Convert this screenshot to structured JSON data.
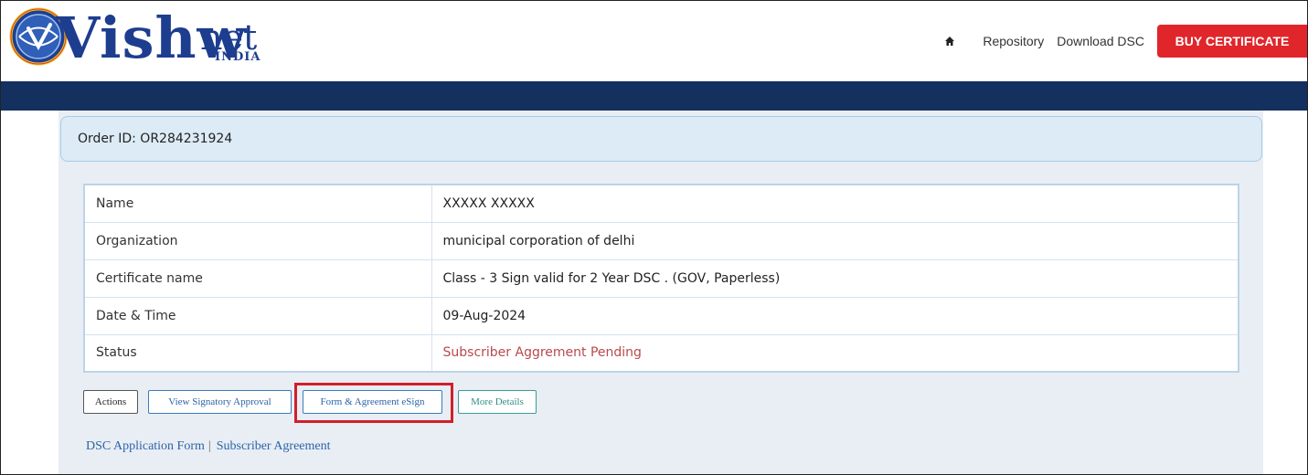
{
  "header": {
    "logo_main": "Vishw",
    "logo_net": "net",
    "logo_india": "INDIA",
    "nav": {
      "home_icon": "home-icon",
      "repository": "Repository",
      "download_dsc": "Download DSC",
      "buy_certificate": "BUY CERTIFICATE"
    }
  },
  "order": {
    "label": "Order ID: OR284231924"
  },
  "details": [
    {
      "label": "Name",
      "value": "XXXXX XXXXX"
    },
    {
      "label": "Organization",
      "value": "municipal corporation of delhi"
    },
    {
      "label": "Certificate name",
      "value": "Class - 3 Sign valid for 2 Year DSC . (GOV, Paperless)"
    },
    {
      "label": "Date & Time",
      "value": "09-Aug-2024"
    },
    {
      "label": "Status",
      "value": "Subscriber Aggrement Pending"
    }
  ],
  "actions": {
    "actions": "Actions",
    "view_signatory": "View Signatory Approval",
    "form_esign": "Form & Agreement eSign",
    "more_details": "More Details"
  },
  "links": {
    "dsc_form": "DSC Application Form",
    "separator": "|",
    "subscriber_agreement": "Subscriber Agreement"
  },
  "colors": {
    "navy": "#14305f",
    "buy_red": "#e0262b",
    "highlight_red": "#d21f2a",
    "status_pending": "#b84a4a",
    "link_blue": "#2d63a8"
  }
}
